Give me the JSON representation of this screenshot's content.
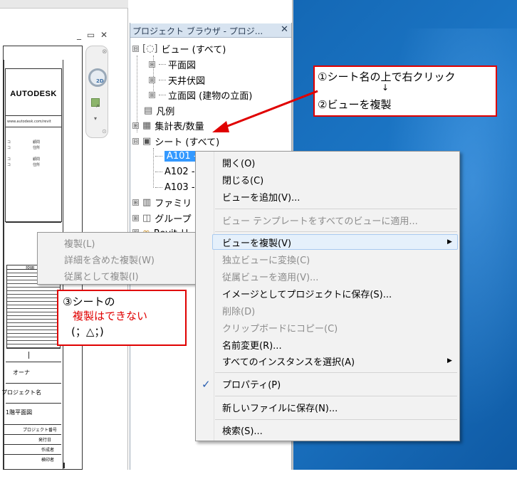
{
  "drawing": {
    "window_controls": "_ ▭ ✕",
    "logo": "AUTODESK",
    "desc_header": "説明",
    "owner": "オーナ",
    "project_name": "プロジェクト名",
    "sheet_title": "1階平面図",
    "rows": [
      "プロジェクト番号",
      "発行日",
      "作成者",
      "検印者"
    ],
    "nav_2d": "2D"
  },
  "browser": {
    "title": "プロジェクト ブラウザ - プロジ...",
    "close": "✕",
    "tree": [
      {
        "label": "ビュー (すべて)",
        "expander": "⊟"
      },
      {
        "label": "平面図",
        "expander": "⊞"
      },
      {
        "label": "天井伏図",
        "expander": "⊞"
      },
      {
        "label": "立面図 (建物の立面)",
        "expander": "⊞"
      },
      {
        "label": "凡例"
      },
      {
        "label": "集計表/数量",
        "expander": "⊞"
      },
      {
        "label": "シート (すべて)",
        "expander": "⊟"
      },
      {
        "label": "A101 -"
      },
      {
        "label": "A102 -"
      },
      {
        "label": "A103 -"
      },
      {
        "label": "ファミリ",
        "expander": "⊞"
      },
      {
        "label": "グループ",
        "expander": "⊞"
      },
      {
        "label": "Revit リ",
        "expander": "⊞"
      }
    ]
  },
  "context_menu": {
    "items": [
      {
        "label": "開く(O)",
        "enabled": true
      },
      {
        "label": "閉じる(C)",
        "enabled": true
      },
      {
        "label": "ビューを追加(V)...",
        "enabled": true
      },
      {
        "label": "ビュー テンプレートをすべてのビューに適用...",
        "enabled": false
      },
      {
        "label": "ビューを複製(V)",
        "enabled": true,
        "submenu": true
      },
      {
        "label": "独立ビューに変換(C)",
        "enabled": false
      },
      {
        "label": "従属ビューを適用(V)...",
        "enabled": false
      },
      {
        "label": "イメージとしてプロジェクトに保存(S)...",
        "enabled": true
      },
      {
        "label": "削除(D)",
        "enabled": false
      },
      {
        "label": "クリップボードにコピー(C)",
        "enabled": false
      },
      {
        "label": "名前変更(R)...",
        "enabled": true
      },
      {
        "label": "すべてのインスタンスを選択(A)",
        "enabled": true,
        "submenu": true
      },
      {
        "label": "プロパティ(P)",
        "enabled": true,
        "checked": true
      },
      {
        "label": "新しいファイルに保存(N)...",
        "enabled": true
      },
      {
        "label": "検索(S)...",
        "enabled": true
      }
    ]
  },
  "submenu": {
    "items": [
      "複製(L)",
      "詳細を含めた複製(W)",
      "従属として複製(I)"
    ]
  },
  "callouts": {
    "top_line1": "①シート名の上で右クリック",
    "top_arrow": "↓",
    "top_line2": "②ビューを複製",
    "bottom_line1": "③シートの",
    "bottom_line2": "複製はできない",
    "bottom_line3": "(；△；)"
  },
  "colors": {
    "accent_red": "#e00000",
    "selection_blue": "#3399ff",
    "desktop_blue": "#1468b5"
  }
}
